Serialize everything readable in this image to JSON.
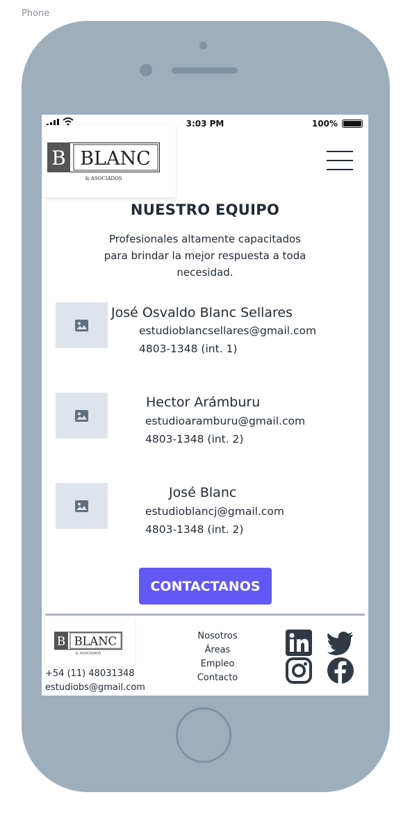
{
  "frame": {
    "label": "Phone"
  },
  "status_bar": {
    "time": "3:03 PM",
    "battery_percent": "100%",
    "battery_level": 1.0,
    "icons": [
      "cell-signal-icon",
      "wifi-icon",
      "battery-icon"
    ]
  },
  "brand": {
    "letter": "B",
    "name": "BLANC",
    "tagline": "& ASOCIADOS"
  },
  "header": {
    "menu_icon": "hamburger-menu-icon"
  },
  "team_section": {
    "title": "NUESTRO EQUIPO",
    "subtitle": "Profesionales altamente capacitados para brindar la mejor respuesta a toda necesidad.",
    "members": [
      {
        "name": "José Osvaldo Blanc Sellares",
        "email": "estudioblancsellares@gmail.com",
        "phone": "4803-1348 (int. 1)",
        "photo_icon": "image-placeholder-icon"
      },
      {
        "name": "Hector Arámburu",
        "email": "estudioaramburu@gmail.com",
        "phone": "4803-1348 (int. 2)",
        "photo_icon": "image-placeholder-icon"
      },
      {
        "name": "José Blanc",
        "email": "estudioblancj@gmail.com",
        "phone": "4803-1348 (int. 2)",
        "photo_icon": "image-placeholder-icon"
      }
    ]
  },
  "cta": {
    "label": "CONTACTANOS"
  },
  "footer": {
    "phone": "+54 (11) 48031348",
    "email": "estudiobs@gmail.com",
    "nav": [
      "Nosotros",
      "Áreas",
      "Empleo",
      "Contacto"
    ],
    "social": [
      "linkedin-icon",
      "twitter-icon",
      "instagram-icon",
      "facebook-icon"
    ]
  },
  "colors": {
    "accent": "#6258f3",
    "text": "#222b36",
    "device": "#9daebd",
    "placeholder": "#dde4ec",
    "divider": "#a8b4c1"
  }
}
